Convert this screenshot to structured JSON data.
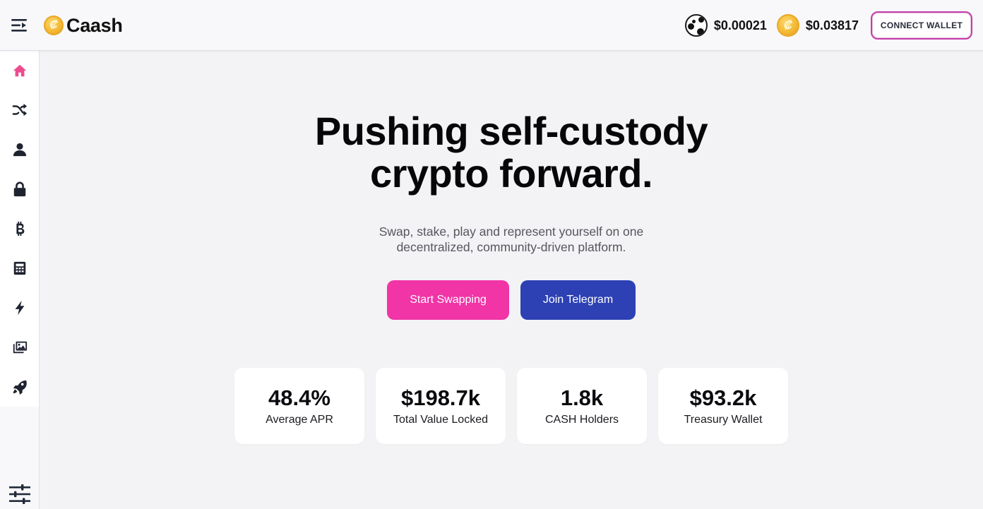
{
  "header": {
    "brand_name": "Caash",
    "brand_logo_glyph": "₡",
    "menu_icon": "menu-expand-icon",
    "prices": [
      {
        "token_icon": "token-a-icon",
        "value": "$0.00021"
      },
      {
        "token_icon": "caash-coin-icon",
        "glyph": "₡",
        "value": "$0.03817"
      }
    ],
    "connect_label": "CONNECT WALLET"
  },
  "sidebar": {
    "items": [
      {
        "icon": "home-icon",
        "active": true
      },
      {
        "icon": "shuffle-icon"
      },
      {
        "icon": "user-icon"
      },
      {
        "icon": "lock-icon"
      },
      {
        "icon": "bitcoin-icon"
      },
      {
        "icon": "calculator-icon"
      },
      {
        "icon": "bolt-icon"
      },
      {
        "icon": "images-icon"
      },
      {
        "icon": "rocket-icon"
      }
    ],
    "settings_icon": "sliders-icon"
  },
  "hero": {
    "title_line1": "Pushing self-custody",
    "title_line2": "crypto forward.",
    "subtitle": "Swap, stake, play and represent yourself on one decentralized, community-driven platform.",
    "primary_cta": "Start Swapping",
    "secondary_cta": "Join Telegram"
  },
  "stats": [
    {
      "value": "48.4%",
      "label": "Average APR"
    },
    {
      "value": "$198.7k",
      "label": "Total Value Locked"
    },
    {
      "value": "1.8k",
      "label": "CASH Holders"
    },
    {
      "value": "$93.2k",
      "label": "Treasury Wallet"
    }
  ],
  "colors": {
    "accent_pink": "#f134a6",
    "accent_blue": "#2d41b4",
    "active_icon": "#ef4b8f",
    "icon_default": "#1f2330"
  }
}
